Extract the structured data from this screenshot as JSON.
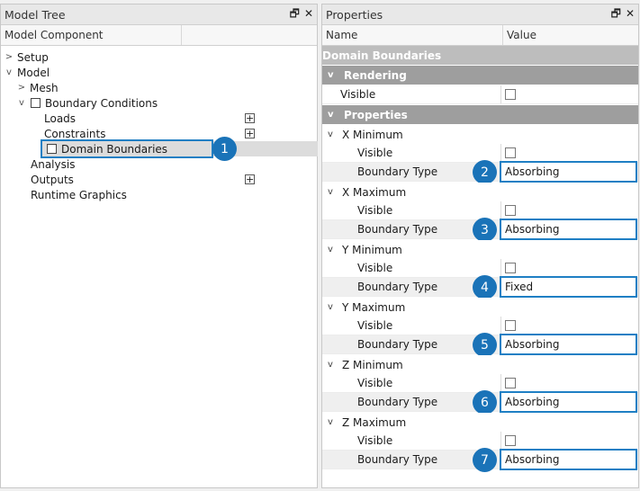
{
  "model_tree": {
    "title": "Model Tree",
    "column_header": "Model Component",
    "items": [
      {
        "label": "Setup"
      },
      {
        "label": "Model"
      },
      {
        "label": "Mesh"
      },
      {
        "label": "Boundary Conditions"
      },
      {
        "label": "Loads"
      },
      {
        "label": "Constraints"
      },
      {
        "label": "Domain Boundaries"
      },
      {
        "label": "Analysis"
      },
      {
        "label": "Outputs"
      },
      {
        "label": "Runtime Graphics"
      }
    ],
    "expand_glyph": "+"
  },
  "properties": {
    "title": "Properties",
    "col_name": "Name",
    "col_value": "Value",
    "top_label": "Domain Boundaries",
    "rendering_label": "Rendering",
    "visible_label": "Visible",
    "properties_label": "Properties",
    "sections": [
      {
        "label": "X Minimum",
        "visible": "Visible",
        "bt_label": "Boundary Type",
        "bt_value": "Absorbing"
      },
      {
        "label": "X Maximum",
        "visible": "Visible",
        "bt_label": "Boundary Type",
        "bt_value": "Absorbing"
      },
      {
        "label": "Y Minimum",
        "visible": "Visible",
        "bt_label": "Boundary Type",
        "bt_value": "Fixed"
      },
      {
        "label": "Y Maximum",
        "visible": "Visible",
        "bt_label": "Boundary Type",
        "bt_value": "Absorbing"
      },
      {
        "label": "Z Minimum",
        "visible": "Visible",
        "bt_label": "Boundary Type",
        "bt_value": "Absorbing"
      },
      {
        "label": "Z Maximum",
        "visible": "Visible",
        "bt_label": "Boundary Type",
        "bt_value": "Absorbing"
      }
    ]
  },
  "header_icons": {
    "restore": "🗗",
    "close": "✕"
  },
  "callouts": [
    "1",
    "2",
    "3",
    "4",
    "5",
    "6",
    "7"
  ],
  "colors": {
    "accent": "#1f7fc4",
    "callout": "#1a73b8",
    "group_header": "#9e9e9e"
  }
}
